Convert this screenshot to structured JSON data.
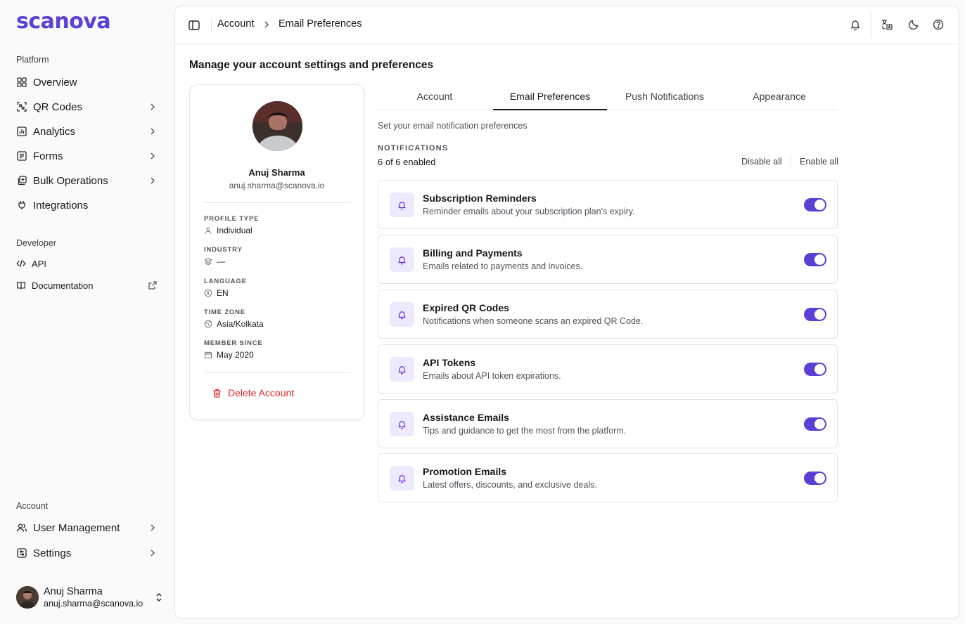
{
  "brand": {
    "logo_text": "scanova",
    "accent": "#5b3fd6"
  },
  "sidebar": {
    "platform_label": "Platform",
    "platform_items": [
      {
        "label": "Overview",
        "icon": "grid-icon",
        "has_chevron": false
      },
      {
        "label": "QR Codes",
        "icon": "qr-scan-icon",
        "has_chevron": true
      },
      {
        "label": "Analytics",
        "icon": "bar-chart-icon",
        "has_chevron": true
      },
      {
        "label": "Forms",
        "icon": "form-icon",
        "has_chevron": true
      },
      {
        "label": "Bulk Operations",
        "icon": "stack-icon",
        "has_chevron": true
      },
      {
        "label": "Integrations",
        "icon": "plug-icon",
        "has_chevron": false
      }
    ],
    "developer_label": "Developer",
    "developer_items": [
      {
        "label": "API",
        "icon": "code-icon"
      },
      {
        "label": "Documentation",
        "icon": "book-icon"
      }
    ],
    "account_label": "Account",
    "account_items": [
      {
        "label": "User Management",
        "icon": "users-icon",
        "has_chevron": true
      },
      {
        "label": "Settings",
        "icon": "settings-icon",
        "has_chevron": true
      }
    ],
    "user": {
      "name": "Anuj Sharma",
      "email": "anuj.sharma@scanova.io"
    }
  },
  "topbar": {
    "breadcrumb": [
      "Account",
      "Email Preferences"
    ],
    "icons": [
      "bell-icon",
      "translate-icon",
      "moon-icon",
      "help-icon"
    ]
  },
  "page": {
    "heading": "Manage your account settings and preferences"
  },
  "profile": {
    "name": "Anuj Sharma",
    "email": "anuj.sharma@scanova.io",
    "fields": [
      {
        "label": "PROFILE TYPE",
        "value": "Individual",
        "icon": "user-icon"
      },
      {
        "label": "INDUSTRY",
        "value": "—",
        "icon": "layers-icon"
      },
      {
        "label": "LANGUAGE",
        "value": "EN",
        "icon": "language-icon"
      },
      {
        "label": "TIME ZONE",
        "value": "Asia/Kolkata",
        "icon": "globe-icon"
      },
      {
        "label": "MEMBER SINCE",
        "value": "May 2020",
        "icon": "calendar-icon"
      }
    ],
    "delete_label": "Delete Account"
  },
  "tabs": [
    {
      "label": "Account",
      "active": false
    },
    {
      "label": "Email Preferences",
      "active": true
    },
    {
      "label": "Push Notifications",
      "active": false
    },
    {
      "label": "Appearance",
      "active": false
    }
  ],
  "email_prefs": {
    "subtitle": "Set your email notification preferences",
    "section_label": "NOTIFICATIONS",
    "count_text": "6 of 6 enabled",
    "disable_all": "Disable all",
    "enable_all": "Enable all",
    "items": [
      {
        "title": "Subscription Reminders",
        "desc": "Reminder emails about your subscription plan's expiry.",
        "enabled": true
      },
      {
        "title": "Billing and Payments",
        "desc": "Emails related to payments and invoices.",
        "enabled": true
      },
      {
        "title": "Expired QR Codes",
        "desc": "Notifications when someone scans an expired QR Code.",
        "enabled": true
      },
      {
        "title": "API Tokens",
        "desc": "Emails about API token expirations.",
        "enabled": true
      },
      {
        "title": "Assistance Emails",
        "desc": "Tips and guidance to get the most from the platform.",
        "enabled": true
      },
      {
        "title": "Promotion Emails",
        "desc": "Latest offers, discounts, and exclusive deals.",
        "enabled": true
      }
    ]
  }
}
